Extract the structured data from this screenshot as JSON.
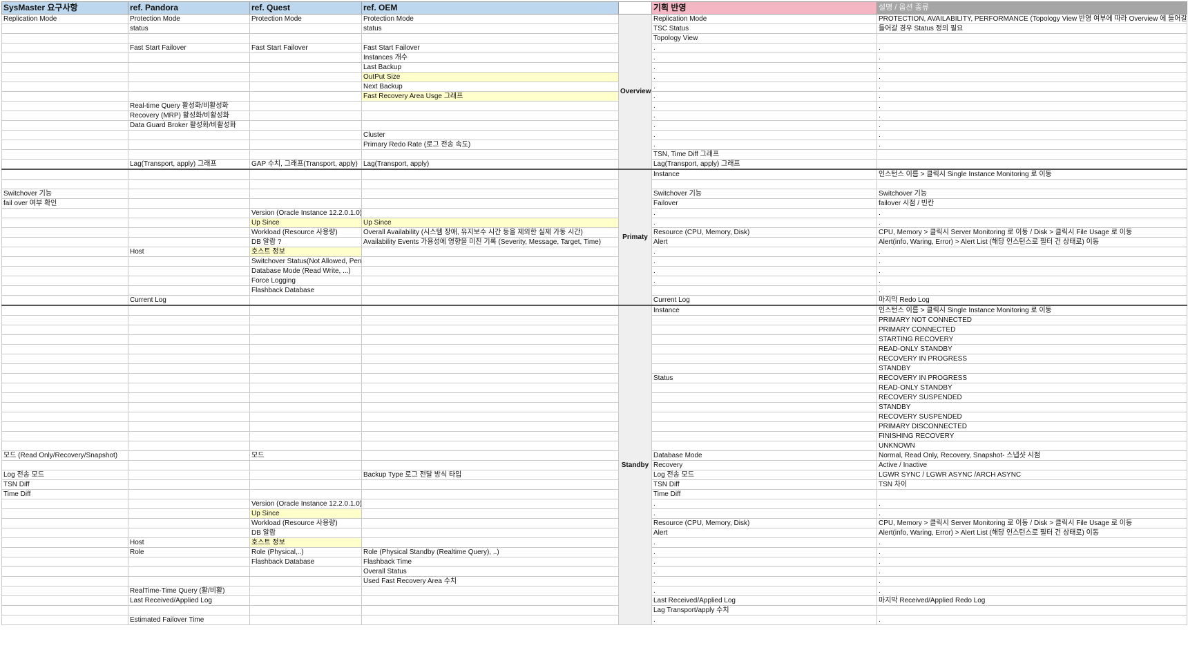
{
  "headers": [
    {
      "label": "SysMaster 요구사항",
      "style": "blue"
    },
    {
      "label": "ref. Pandora",
      "style": "blue"
    },
    {
      "label": "ref. Quest",
      "style": "blue"
    },
    {
      "label": "ref. OEM",
      "style": "blue"
    },
    {
      "label": "",
      "style": "blank"
    },
    {
      "label": "기획 반영",
      "style": "pink"
    },
    {
      "label": "설명 / 옵션 종류",
      "style": "gray"
    }
  ],
  "sections": [
    {
      "name": "Overview",
      "rows": [
        [
          "Replication Mode",
          "Protection Mode",
          "Protection Mode",
          "Protection Mode",
          "Replication Mode",
          "PROTECTION, AVAILABILITY, PERFORMANCE (Topology View 반영 여부에 따라 Overview 에 들어갈지"
        ],
        [
          "",
          "status",
          "",
          "status",
          "TSC Status",
          "들어갈 경우 Status 정의 필요"
        ],
        [
          "",
          "",
          "",
          "",
          "Topology View",
          ""
        ],
        [
          "",
          "Fast Start Failover",
          "Fast Start Failover",
          "Fast Start Failover",
          ".",
          "."
        ],
        [
          "",
          "",
          "",
          "Instances 개수",
          ".",
          "."
        ],
        [
          "",
          "",
          "",
          "Last Backup",
          ".",
          "."
        ],
        [
          "",
          "",
          "",
          "OutPut Size",
          ".",
          "."
        ],
        [
          "",
          "",
          "",
          "Next Backup",
          ".",
          "."
        ],
        [
          "",
          "",
          "",
          "Fast Recovery Area Usge 그래프",
          ".",
          "."
        ],
        [
          "",
          "Real-time Query 활성화/비활성화",
          "",
          "",
          ".",
          "."
        ],
        [
          "",
          "Recovery (MRP) 활성화/비활성화",
          "",
          "",
          ".",
          "."
        ],
        [
          "",
          "Data Guard Broker 활성화/비활성화",
          "",
          "",
          ".",
          "."
        ],
        [
          "",
          "",
          "",
          "Cluster",
          ".",
          "."
        ],
        [
          "",
          "",
          "",
          "Primary Redo Rate (로그 전송 속도)",
          ".",
          "."
        ],
        [
          "",
          "",
          "",
          "",
          "TSN, Time Diff 그래프",
          ""
        ],
        [
          "",
          "Lag(Transport, apply) 그래프",
          "GAP 수치, 그래프(Transport, apply)",
          "Lag(Transport, apply)",
          "Lag(Transport, apply) 그래프",
          ""
        ]
      ]
    },
    {
      "name": "Primaty",
      "rows": [
        [
          "",
          "",
          "",
          "",
          "Instance",
          "인스턴스 이름 > 클릭시 Single Instance Monitoring 로 이동"
        ],
        [
          "",
          "",
          "",
          "",
          "",
          ""
        ],
        [
          "Switchover 기능",
          "",
          "",
          "",
          "Switchover 기능",
          "Switchover 기능"
        ],
        [
          "fail over 여부 확인",
          "",
          "",
          "",
          "Failover",
          "failover 시점 / 빈칸"
        ],
        [
          "",
          "",
          "Version (Oracle Instance 12.2.0.1.0)",
          "",
          ".",
          "."
        ],
        [
          "",
          "",
          "Up Since",
          "Up Since",
          ".",
          "."
        ],
        [
          "",
          "",
          "Workload (Resource 사용량)",
          "Overall Availability (시스템 장애, 유지보수 시간 등을 제외한 실제 가동 시간)",
          "Resource (CPU, Memory, Disk)",
          "CPU, Memory > 클릭시 Server Monitoring 로 이동 / Disk > 클릭시 File Usage 로 이동"
        ],
        [
          "",
          "",
          "DB 알람 ?",
          "Availability Events 가용성에 영향을 미친 기록 (Severity, Message, Target, Time)",
          "Alert",
          "Alert(info, Waring, Error) > Alert List (해당 인스턴스로 필터 건 상태로) 이동"
        ],
        [
          "",
          "Host",
          "호스트 정보",
          "",
          ".",
          "."
        ],
        [
          "",
          "",
          "Switchover Status(Not Allowed, Pending, To Primary, To Standby)",
          "",
          ".",
          "."
        ],
        [
          "",
          "",
          "Database Mode (Read Write, ...)",
          "",
          ".",
          "."
        ],
        [
          "",
          "",
          "Force Logging",
          "",
          ".",
          "."
        ],
        [
          "",
          "",
          "Flashback Database",
          "",
          "",
          "."
        ],
        [
          "",
          "Current Log",
          "",
          "",
          "Current Log",
          "마지막 Redo Log"
        ]
      ]
    },
    {
      "name": "Standby",
      "rows": [
        [
          "",
          "",
          "",
          "",
          "Instance",
          "인스턴스 이름 > 클릭시 Single Instance Monitoring 로 이동"
        ],
        [
          "",
          "",
          "",
          "",
          "",
          "PRIMARY NOT CONNECTED"
        ],
        [
          "",
          "",
          "",
          "",
          "",
          "PRIMARY CONNECTED"
        ],
        [
          "",
          "",
          "",
          "",
          "",
          "STARTING RECOVERY"
        ],
        [
          "",
          "",
          "",
          "",
          "",
          "READ-ONLY STANDBY"
        ],
        [
          "",
          "",
          "",
          "",
          "",
          "RECOVERY IN PROGRESS"
        ],
        [
          "",
          "",
          "",
          "",
          "",
          "STANDBY"
        ],
        [
          "",
          "",
          "",
          "",
          "Status",
          "RECOVERY IN PROGRESS"
        ],
        [
          "",
          "",
          "",
          "",
          "",
          "READ-ONLY STANDBY"
        ],
        [
          "",
          "",
          "",
          "",
          "",
          "RECOVERY SUSPENDED"
        ],
        [
          "",
          "",
          "",
          "",
          "",
          "STANDBY"
        ],
        [
          "",
          "",
          "",
          "",
          "",
          "RECOVERY SUSPENDED"
        ],
        [
          "",
          "",
          "",
          "",
          "",
          "PRIMARY DISCONNECTED"
        ],
        [
          "",
          "",
          "",
          "",
          "",
          "FINISHING RECOVERY"
        ],
        [
          "",
          "",
          "",
          "",
          "",
          "UNKNOWN"
        ],
        [
          "모드 (Read Only/Recovery/Snapshot)",
          "",
          "모드",
          "",
          "Database Mode",
          "Normal, Read Only, Recovery, Snapshot- 스냅샷 시점"
        ],
        [
          "",
          "",
          "",
          "",
          "Recovery",
          "Active / Inactive"
        ],
        [
          "Log 전송 모드",
          "",
          "",
          "Backup Type 로그 전달 방식 타입",
          "Log 전송 모드",
          "LGWR SYNC / LGWR ASYNC /ARCH ASYNC"
        ],
        [
          "TSN Diff",
          "",
          "",
          "",
          "TSN Diff",
          "TSN 차이"
        ],
        [
          "Time Diff",
          "",
          "",
          "",
          "Time Diff",
          ""
        ],
        [
          "",
          "",
          "Version (Oracle Instance 12.2.0.1.0)",
          "",
          ".",
          "."
        ],
        [
          "",
          "",
          "Up Since",
          "",
          ".",
          "."
        ],
        [
          "",
          "",
          "Workload (Resource 사용량)",
          "",
          "Resource (CPU, Memory, Disk)",
          "CPU, Memory > 클릭시 Server Monitoring 로 이동 / Disk > 클릭시 File Usage 로 이동"
        ],
        [
          "",
          "",
          "DB 알람",
          "",
          "Alert",
          "Alert(info, Waring, Error) > Alert List (해당 인스턴스로 필터 건 상태로) 이동"
        ],
        [
          "",
          "Host",
          "호스트 정보",
          "",
          ".",
          "."
        ],
        [
          "",
          "Role",
          "Role (Physical,..)",
          "Role (Physical Standby (Realtime Query), ..)",
          ".",
          "."
        ],
        [
          "",
          "",
          "Flashback Database",
          "Flashback Time",
          ".",
          "."
        ],
        [
          "",
          "",
          "",
          "Overall Status",
          ".",
          "."
        ],
        [
          "",
          "",
          "",
          "Used Fast Recovery Area 수치",
          ".",
          "."
        ],
        [
          "",
          "RealTime-Time Query (활/비활)",
          "",
          "",
          ".",
          "."
        ],
        [
          "",
          "Last Received/Applied Log",
          "",
          "",
          "Last Received/Applied Log",
          "마지막 Received/Applied Redo Log"
        ],
        [
          "",
          "",
          "",
          "",
          "Lag Transport/apply 수치",
          ""
        ],
        [
          "",
          "Estimated Failover Time",
          "",
          "",
          ".",
          "."
        ]
      ]
    }
  ]
}
